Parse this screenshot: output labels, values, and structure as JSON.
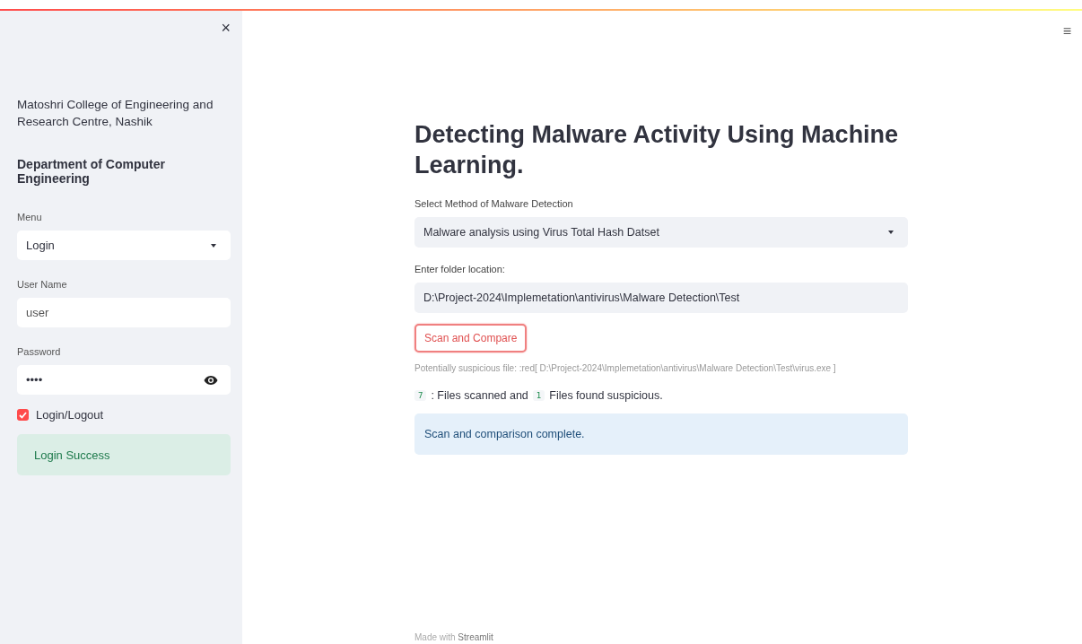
{
  "sidebar": {
    "close_icon": "×",
    "college": "Matoshri College of Engineering and Research Centre, Nashik",
    "department": "Department of Computer Engineering",
    "menu": {
      "label": "Menu",
      "value": "Login"
    },
    "username": {
      "label": "User Name",
      "value": "user"
    },
    "password": {
      "label": "Password",
      "value": "••••"
    },
    "login_toggle": {
      "label": "Login/Logout",
      "checked": true
    },
    "alert": {
      "text": "Login Success"
    }
  },
  "header": {
    "menu_icon": "≡"
  },
  "main": {
    "title": "Detecting Malware Activity Using Machine Learning.",
    "method": {
      "label": "Select Method of Malware Detection",
      "value": "Malware analysis using Virus Total Hash Datset"
    },
    "folder": {
      "label": "Enter folder location:",
      "value": "D:\\Project-2024\\Implemetation\\antivirus\\Malware Detection\\Test"
    },
    "scan_button": "Scan and Compare",
    "suspicious_note": "Potentially suspicious file: :red[ D:\\Project-2024\\Implemetation\\antivirus\\Malware Detection\\Test\\virus.exe ]",
    "summary": [
      {
        "kind": "code",
        "text": "7"
      },
      {
        "kind": "text",
        "text": ": Files scanned and"
      },
      {
        "kind": "code",
        "text": "1"
      },
      {
        "kind": "text",
        "text": "Files found suspicious."
      }
    ],
    "info": "Scan and comparison complete.",
    "footer": "Made with **Streamlit**"
  }
}
